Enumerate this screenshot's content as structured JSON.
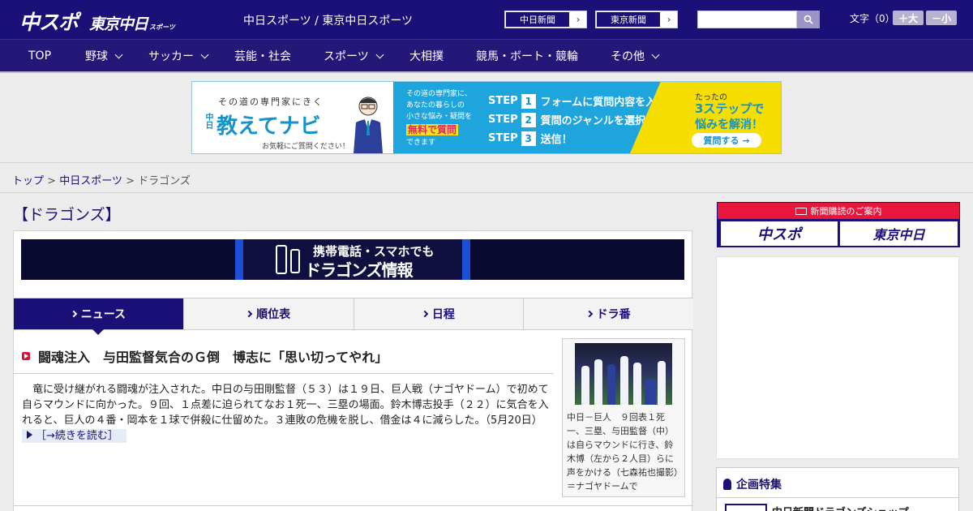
{
  "header": {
    "logo_main": "中スポ",
    "logo_sub": "東京中日",
    "logo_tiny": "スポーツ",
    "site_title": "中日スポーツ / 東京中日スポーツ",
    "paper_links": [
      "中日新聞",
      "東京新聞"
    ],
    "search": {
      "placeholder": "",
      "button_icon": "search-icon"
    },
    "font_size": {
      "label": "文字（0）",
      "larger": "＋大",
      "smaller": "－小"
    }
  },
  "nav": {
    "items": [
      {
        "label": "TOP",
        "dropdown": false
      },
      {
        "label": "野球",
        "dropdown": true
      },
      {
        "label": "サッカー",
        "dropdown": true
      },
      {
        "label": "芸能・社会",
        "dropdown": false
      },
      {
        "label": "スポーツ",
        "dropdown": true
      },
      {
        "label": "大相撲",
        "dropdown": false
      },
      {
        "label": "競馬・ボート・競輪",
        "dropdown": false
      },
      {
        "label": "その他",
        "dropdown": true
      }
    ]
  },
  "ad": {
    "tagline": "その道の専門家にきく",
    "brand_small": "中日",
    "brand": "教えてナビ",
    "footnote": "お気軽にご質問ください！",
    "mid_text": [
      "その道の専門家に、",
      "あなたの暮らしの",
      "小さな悩み・疑問を"
    ],
    "mid_highlight": "無料で質問",
    "mid_tail": "できます",
    "steps": [
      {
        "step": "STEP",
        "num": "1",
        "text": "フォームに質問内容を入力"
      },
      {
        "step": "STEP",
        "num": "2",
        "text": "質問のジャンルを選択"
      },
      {
        "step": "STEP",
        "num": "3",
        "text": "送信！"
      }
    ],
    "right_line1": "たったの",
    "right_line2": "3ステップで",
    "right_line3": "悩みを解消！",
    "cta": "質問する →"
  },
  "breadcrumb": {
    "items": [
      "トップ",
      "中日スポーツ"
    ],
    "separator": ">",
    "current": "ドラゴンズ"
  },
  "page": {
    "heading": "【ドラゴンズ】",
    "mobile_banner_line1": "携帯電話・スマホでも",
    "mobile_banner_line2": "ドラゴンズ情報",
    "tabs": [
      {
        "label": "ニュース",
        "active": true
      },
      {
        "label": "順位表",
        "active": false
      },
      {
        "label": "日程",
        "active": false
      },
      {
        "label": "ドラ番",
        "active": false
      }
    ]
  },
  "article": {
    "title": "闘魂注入　与田監督気合のＧ倒　博志に「思い切ってやれ」",
    "body": "　竜に受け継がれる闘魂が注入された。中日の与田剛監督（５３）は１９日、巨人戦（ナゴヤドーム）で初めて自らマウンドに向かった。９回、１点差に迫られてなお１死一、三塁の場面。鈴木博志投手（２２）に気合を入れると、巨人の４番・岡本を１球で併殺に仕留めた。３連敗の危機を脱し、借金は４に減らした。",
    "date": "（5月20日）",
    "read_more": "［→続きを読む］",
    "photo_caption": "中日－巨人　９回表１死一、三塁、与田監督（中）は自らマウンドに行き、鈴木博（左から２人目）らに声をかける（七森祐也撮影）＝ナゴヤドームで"
  },
  "sidebar": {
    "subscription_title": "新聞購読のご案内",
    "subscription_cards": [
      "中スポ",
      "東京中日"
    ],
    "feature_title": "企画特集",
    "feature_item": "中日新聞ドラゴンズショップ"
  },
  "colors": {
    "brand_navy": "#1b0f78",
    "accent_red": "#d6143b",
    "ad_blue": "#1fa5de",
    "ad_yellow": "#f6de00"
  }
}
